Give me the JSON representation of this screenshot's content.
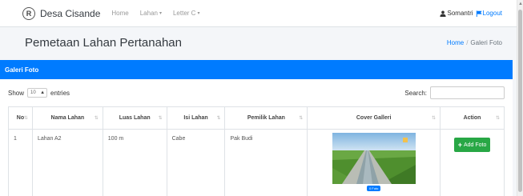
{
  "navbar": {
    "logo_letter": "R",
    "brand": "Desa Cisande",
    "links": [
      {
        "label": "Home",
        "caret": ""
      },
      {
        "label": "Lahan",
        "caret": "▾"
      },
      {
        "label": "Letter C",
        "caret": "▾"
      }
    ],
    "user": "Somantri",
    "logout": "Logout"
  },
  "header": {
    "title": "Pemetaan Lahan Pertanahan",
    "breadcrumb_home": "Home",
    "breadcrumb_sep": "/",
    "breadcrumb_active": "Galeri Foto"
  },
  "card": {
    "title": "Galeri Foto",
    "show_label": "Show",
    "entries_value": "10",
    "entries_label": "entries",
    "search_label": "Search:",
    "search_value": ""
  },
  "table": {
    "columns": [
      "No",
      "Nama Lahan",
      "Luas Lahan",
      "Isi Lahan",
      "Pemilik Lahan",
      "Cover Galleri",
      "Action"
    ],
    "rows": [
      {
        "no": "1",
        "nama": "Lahan A2",
        "luas": "100 m",
        "isi": "Cabe",
        "pemilik": "Pak Budi",
        "badge": "0 Foto",
        "action": "Add Foto"
      }
    ]
  },
  "colors": {
    "primary": "#007bff",
    "success": "#28a745",
    "background": "#f4f6f9"
  }
}
